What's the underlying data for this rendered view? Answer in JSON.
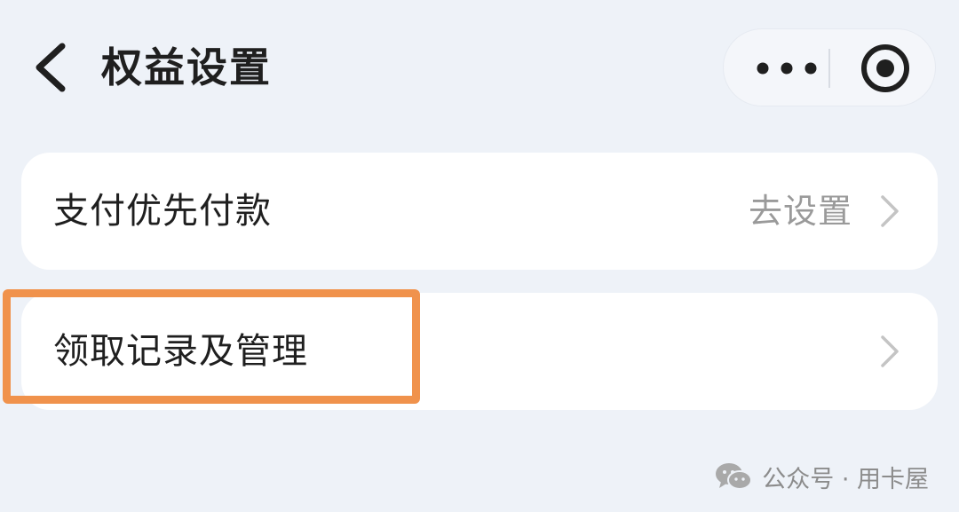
{
  "header": {
    "title": "权益设置",
    "back_icon": "back-chevron-icon",
    "more_icon": "more-dots-icon",
    "close_icon": "target-circle-icon"
  },
  "items": [
    {
      "label": "支付优先付款",
      "action": "去设置",
      "icon": "chevron-right-icon"
    },
    {
      "label": "领取记录及管理",
      "action": "",
      "icon": "chevron-right-icon"
    }
  ],
  "annotation": {
    "color": "#f0924c"
  },
  "watermark": {
    "text": "公众号 · 用卡屋",
    "icon": "wechat-icon"
  },
  "colors": {
    "background": "#eef2f8",
    "card": "#ffffff",
    "title": "#1f1f1f",
    "secondary_text": "#9a9a9a"
  }
}
